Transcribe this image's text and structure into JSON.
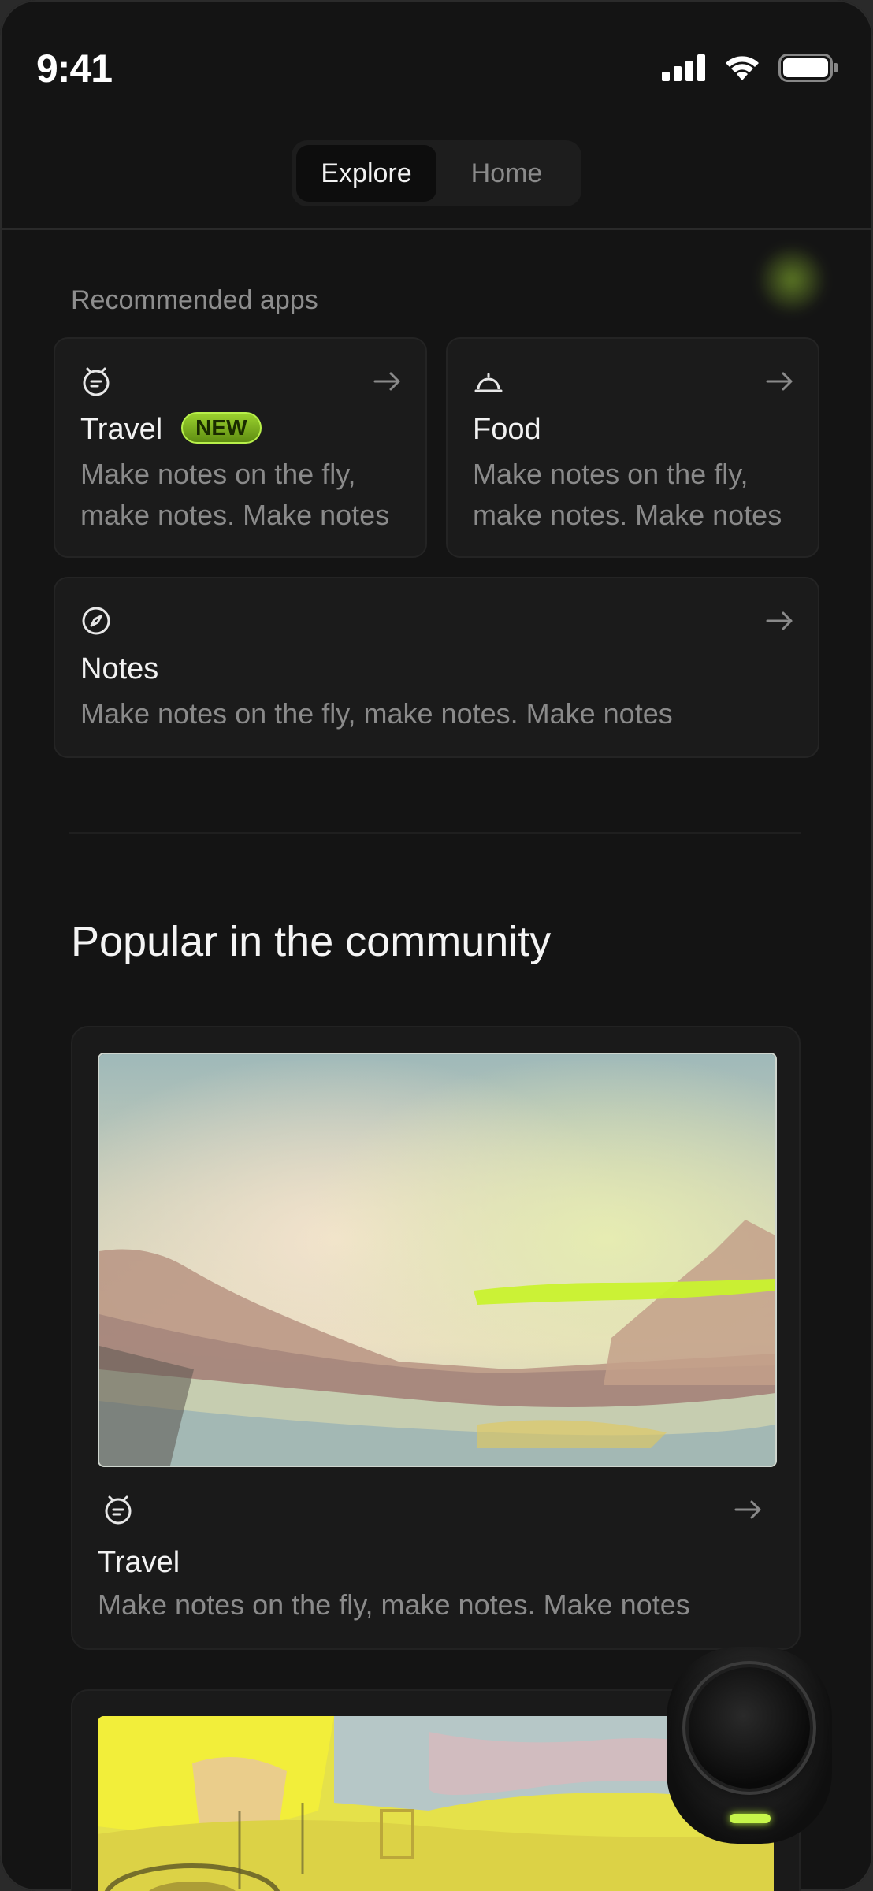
{
  "status_bar": {
    "time": "9:41",
    "icons": [
      "signal-icon",
      "wifi-icon",
      "battery-icon"
    ]
  },
  "tabs": {
    "explore_label": "Explore",
    "home_label": "Home",
    "active": "Explore"
  },
  "recommended": {
    "label": "Recommended apps",
    "items": [
      {
        "title": "Travel",
        "badge": "NEW",
        "description_line1": "Make notes on the fly,",
        "description_line2": "make notes. Make notes",
        "icon": "travel-icon"
      },
      {
        "title": "Food",
        "description_line1": "Make notes on the fly,",
        "description_line2": "make notes. Make notes",
        "icon": "food-cloche-icon"
      },
      {
        "title": "Notes",
        "description": "Make notes on the fly, make notes. Make notes",
        "icon": "compass-icon"
      }
    ]
  },
  "community": {
    "heading": "Popular in the community",
    "items": [
      {
        "title": "Travel",
        "description": "Make notes on the fly, make notes. Make notes",
        "icon": "travel-icon",
        "image": "landscape-painting"
      }
    ]
  },
  "colors": {
    "accent": "#b5ec35",
    "background": "#141414",
    "card": "#1b1b1b"
  }
}
